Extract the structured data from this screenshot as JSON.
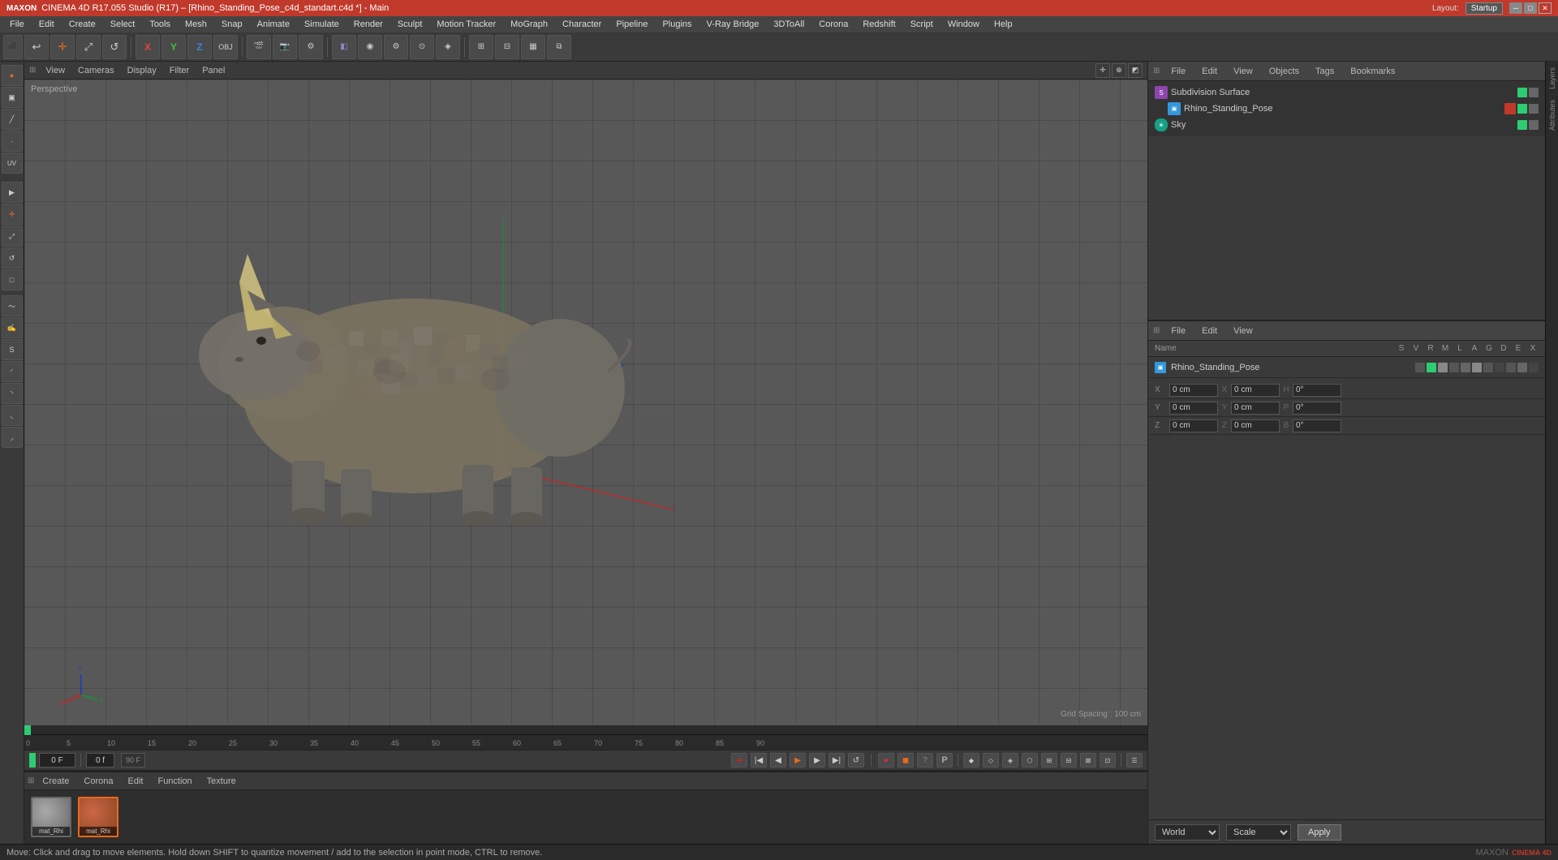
{
  "titlebar": {
    "title": "CINEMA 4D R17.055 Studio (R17) – [Rhino_Standing_Pose_c4d_standart.c4d *] - Main",
    "layout_label": "Layout:",
    "layout_value": "Startup"
  },
  "menubar": {
    "items": [
      "File",
      "Edit",
      "Create",
      "Select",
      "Tools",
      "Mesh",
      "Snap",
      "Animate",
      "Simulate",
      "Render",
      "Sculpt",
      "Motion Tracker",
      "MoGraph",
      "Character",
      "Pipeline",
      "Plugins",
      "V-Ray Bridge",
      "3DToAll",
      "Corona",
      "Redshift",
      "Script",
      "Window",
      "Help"
    ]
  },
  "viewport": {
    "label": "Perspective",
    "grid_spacing": "Grid Spacing : 100 cm",
    "menus": [
      "View",
      "Cameras",
      "Display",
      "Filter",
      "Panel"
    ]
  },
  "object_manager": {
    "title": "Objects",
    "menus": [
      "File",
      "Edit",
      "View",
      "Objects",
      "Tags",
      "Bookmarks"
    ],
    "items": [
      {
        "name": "Subdivision Surface",
        "type": "subdiv",
        "color": "#8e44ad",
        "indent": 0
      },
      {
        "name": "Rhino_Standing_Pose",
        "type": "poly",
        "color": "#e74c3c",
        "indent": 1
      },
      {
        "name": "Sky",
        "type": "sky",
        "color": "#3498db",
        "indent": 0
      }
    ]
  },
  "attributes": {
    "title": "Attributes",
    "menus": [
      "File",
      "Edit",
      "View"
    ],
    "object_name": "Rhino_Standing_Pose",
    "columns": [
      "Name",
      "S",
      "V",
      "R",
      "M",
      "L",
      "A",
      "G",
      "D",
      "E",
      "X"
    ],
    "coords": [
      {
        "axis": "X",
        "val1": "0 cm",
        "axis2": "X",
        "val2": "0 cm",
        "axis3": "H",
        "val3": "0°"
      },
      {
        "axis": "Y",
        "val1": "0 cm",
        "axis2": "Y",
        "val2": "0 cm",
        "axis3": "P",
        "val3": "0°"
      },
      {
        "axis": "Z",
        "val1": "0 cm",
        "axis2": "Z",
        "val2": "0 cm",
        "axis3": "B",
        "val3": "0°"
      }
    ],
    "bottom": {
      "world_label": "World",
      "scale_label": "Scale",
      "apply_label": "Apply"
    }
  },
  "timeline": {
    "current_frame": "0 F",
    "end_frame": "90 F",
    "fps": "0 f",
    "markers": [
      0,
      5,
      10,
      15,
      20,
      25,
      30,
      35,
      40,
      45,
      50,
      55,
      60,
      65,
      70,
      75,
      80,
      85,
      90
    ]
  },
  "materials": {
    "menus": [
      "Create",
      "Corona",
      "Edit",
      "Function",
      "Texture"
    ],
    "items": [
      {
        "name": "mat_Rhi",
        "type": "grey"
      },
      {
        "name": "mat_Rhi",
        "type": "red-grey",
        "selected": true
      }
    ]
  },
  "statusbar": {
    "text": "Move: Click and drag to move elements. Hold down SHIFT to quantize movement / add to the selection in point mode, CTRL to remove."
  },
  "icons": {
    "move": "✛",
    "rotate": "↺",
    "scale": "⤢",
    "select": "▣",
    "play": "▶",
    "stop": "■",
    "rewind": "⏮",
    "forward": "⏭"
  }
}
